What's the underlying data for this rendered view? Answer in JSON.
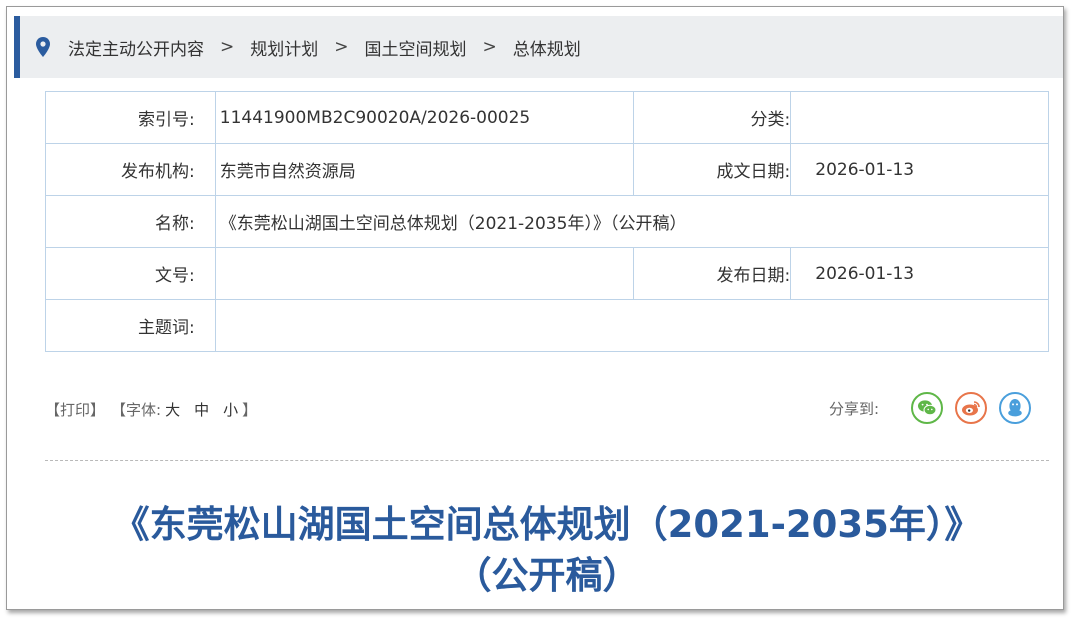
{
  "breadcrumb": {
    "items": [
      "法定主动公开内容",
      "规划计划",
      "国土空间规划",
      "总体规划"
    ],
    "separator": ">"
  },
  "meta": {
    "index_label": "索引号:",
    "index_value": "11441900MB2C90020A/2026-00025",
    "category_label": "分类:",
    "category_value": "",
    "publisher_label": "发布机构:",
    "publisher_value": "东莞市自然资源局",
    "written_date_label": "成文日期:",
    "written_date_value": "2026-01-13",
    "name_label": "名称:",
    "name_value": "《东莞松山湖国土空间总体规划（2021-2035年）》（公开稿）",
    "doc_no_label": "文号:",
    "doc_no_value": "",
    "publish_date_label": "发布日期:",
    "publish_date_value": "2026-01-13",
    "keywords_label": "主题词:",
    "keywords_value": ""
  },
  "tools": {
    "print": "【打印】",
    "font_prefix": "【字体:",
    "font_large": "大",
    "font_medium": "中",
    "font_small": "小",
    "font_suffix": "】"
  },
  "share": {
    "label": "分享到:",
    "icons": [
      "wechat-icon",
      "weibo-icon",
      "qq-icon"
    ]
  },
  "document": {
    "title_line1": "《东莞松山湖国土空间总体规划（2021-2035年）》",
    "title_line2": "（公开稿）"
  },
  "colors": {
    "accent": "#2b5c9f",
    "title": "#2a5a9c",
    "table_border": "#bdd3e8",
    "wechat": "#5fb748",
    "weibo": "#e8754a",
    "qq": "#4a9fdc"
  }
}
